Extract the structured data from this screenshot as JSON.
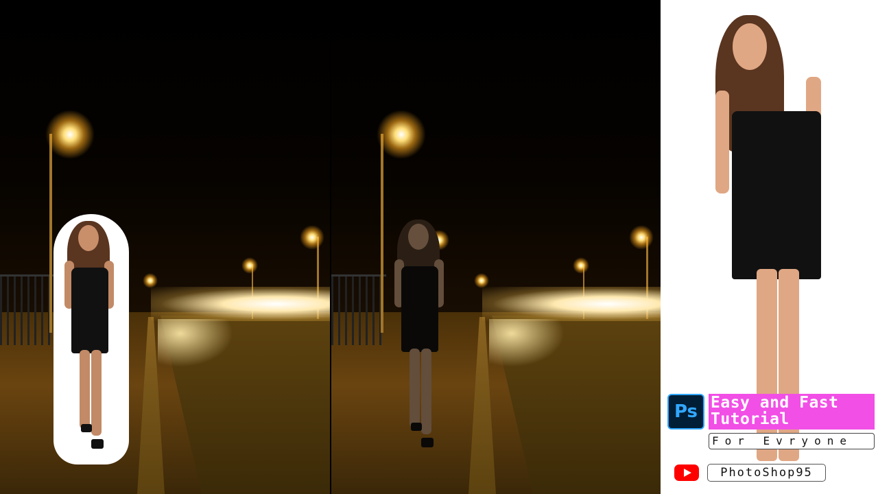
{
  "panels": {
    "left": {
      "description_label": "composite-cutout"
    },
    "middle": {
      "description_label": "composite-final"
    },
    "right": {
      "description_label": "original-subject"
    }
  },
  "branding": {
    "ps_logo_text": "Ps",
    "title_line1": "Easy and Fast",
    "title_line2": "Tutorial",
    "subtitle": "For Evryone",
    "channel_name": "PhotoShop95"
  },
  "colors": {
    "title_bg": "#f14fe6",
    "ps_blue": "#31a8ff",
    "ps_dark": "#001e36",
    "youtube_red": "#ff0000"
  },
  "icons": [
    "photoshop-logo-icon",
    "youtube-icon"
  ]
}
